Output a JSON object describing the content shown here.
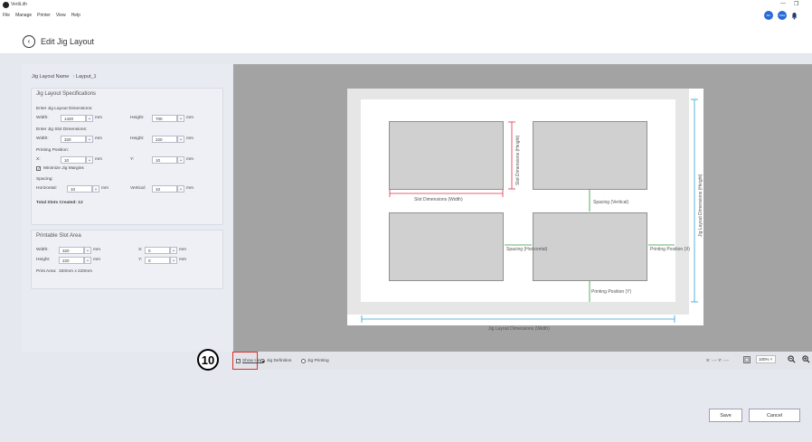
{
  "app": {
    "title": "VertiLith",
    "minimize": "—",
    "restore": "❐"
  },
  "menu": [
    "File",
    "Manage",
    "Printer",
    "View",
    "Help"
  ],
  "topbar": {
    "user_initials": "MC",
    "org_initials": "ORG"
  },
  "header": {
    "title": "Edit Jig Layout",
    "back_glyph": "‹"
  },
  "layout_name": {
    "label": "Jig Layout Name",
    "value": ": Layput_1"
  },
  "specs": {
    "title": "Jig Layout Specifications",
    "layout_dims_label": "Enter Jig Layout Dimensions:",
    "width_label": "Width:",
    "height_label": "Height:",
    "layout_width": "1420",
    "layout_height": "700",
    "slot_dims_label": "Enter Jig Slot Dimensions:",
    "slot_width": "320",
    "slot_height": "220",
    "printing_position_label": "Printing Position:",
    "x_label": "X:",
    "y_label": "Y:",
    "pos_x": "10",
    "pos_y": "10",
    "minimize_margins_label": "Minimize Jig Margins",
    "spacing_label": "Spacing:",
    "horizontal_label": "Horizontal:",
    "vertical_label": "Vertical:",
    "spacing_h": "10",
    "spacing_v": "10",
    "unit": "mm",
    "total_slots": "Total Slots Created: 12"
  },
  "printable": {
    "title": "Printable Slot Area",
    "width_label": "Width:",
    "height_label": "Height:",
    "x_label": "X:",
    "y_label": "Y:",
    "width": "320",
    "height": "220",
    "x": "0",
    "y": "0",
    "unit": "mm",
    "print_area_label": "Print Area:",
    "print_area_value": "320mm x 220mm"
  },
  "diagram": {
    "slot_width_label": "Slot Dimensions (Width)",
    "slot_height_label": "Slot Dimensions (Height)",
    "spacing_vertical": "Spacing (Vertical)",
    "spacing_horizontal": "Spacing (Horizontal)",
    "printing_x": "Printing Position (X)",
    "printing_y": "Printing Position (Y)",
    "layout_width": "Jig Layout Dimensions (Width)",
    "layout_height": "Jig Layout Dimensions (Height)"
  },
  "toolbar": {
    "callout_number": "10",
    "show_hint": "Show Hint",
    "jig_definition": "Jig Definition",
    "jig_printing": "Jig Printing",
    "coords": "X: -.-- Y: -.--",
    "zoom": "100%"
  },
  "footer": {
    "save": "Save",
    "cancel": "Cancel"
  },
  "colors": {
    "dim_blue": "#2aa0d8",
    "dim_red": "#d9334a",
    "dim_green": "#2e9a3e",
    "highlight": "#d9332b"
  }
}
